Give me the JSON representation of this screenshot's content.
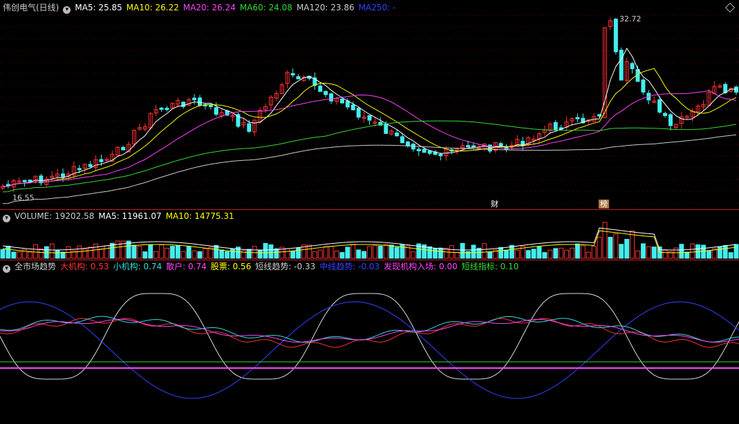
{
  "main": {
    "stock": "伟创电气(日线)",
    "ma": [
      {
        "label": "MA5: 25.85",
        "color": "#ffffff"
      },
      {
        "label": "MA10: 26.22",
        "color": "#ffff00"
      },
      {
        "label": "MA20: 26.24",
        "color": "#ff44ff"
      },
      {
        "label": "MA60: 24.08",
        "color": "#33dd33"
      },
      {
        "label": "MA120: 23.86",
        "color": "#cccccc"
      },
      {
        "label": "MA250: -",
        "color": "#3344ff"
      }
    ],
    "high_label": "32.72",
    "low_label": "16.55",
    "tag_cai": "财",
    "tag_bang": "榜"
  },
  "volume": {
    "items": [
      {
        "label": "VOLUME: 19202.58",
        "color": "#cccccc"
      },
      {
        "label": "MA5: 11961.07",
        "color": "#ffffff"
      },
      {
        "label": "MA10: 14775.31",
        "color": "#ffff00"
      }
    ]
  },
  "indicator": {
    "items": [
      {
        "label": "全市场趋势",
        "color": "#cccccc"
      },
      {
        "label": "大机构: 0.53",
        "color": "#ff3333"
      },
      {
        "label": "小机构: 0.74",
        "color": "#33dddd"
      },
      {
        "label": "散户: 0.74",
        "color": "#ff44ff"
      },
      {
        "label": "股票: 0.56",
        "color": "#ffff00"
      },
      {
        "label": "短线趋势: -0.33",
        "color": "#cccccc"
      },
      {
        "label": "中线趋势: -0.03",
        "color": "#3344ff"
      },
      {
        "label": "发现机构入场: 0.00",
        "color": "#ff44ff"
      },
      {
        "label": "短线指标: 0.10",
        "color": "#33dd33"
      }
    ]
  },
  "colors": {
    "up": "#ff3333",
    "down": "#44eeee",
    "grid": "#7a0000",
    "separator": "#c81e1e"
  }
}
